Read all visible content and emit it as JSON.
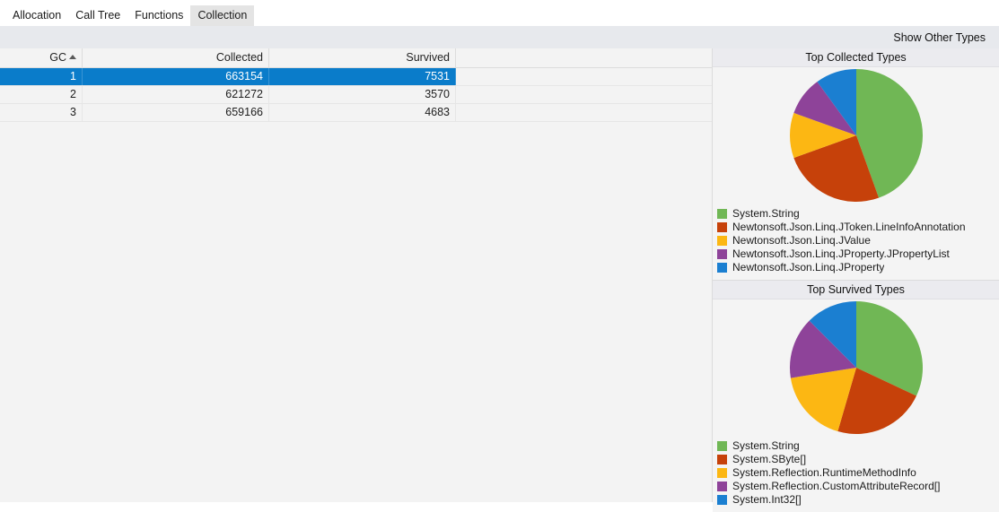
{
  "tabs": [
    {
      "label": "Allocation",
      "selected": false
    },
    {
      "label": "Call Tree",
      "selected": false
    },
    {
      "label": "Functions",
      "selected": false
    },
    {
      "label": "Collection",
      "selected": true
    }
  ],
  "toolbar": {
    "show_other_types_label": "Show Other Types"
  },
  "grid": {
    "columns": [
      {
        "key": "gc",
        "label": "GC",
        "sorted": true,
        "sort_direction": "ascending"
      },
      {
        "key": "collected",
        "label": "Collected",
        "sorted": false
      },
      {
        "key": "survived",
        "label": "Survived",
        "sorted": false
      },
      {
        "key": "filler",
        "label": "",
        "sorted": false
      }
    ],
    "rows": [
      {
        "gc": "1",
        "collected": "663154",
        "survived": "7531",
        "selected": true
      },
      {
        "gc": "2",
        "collected": "621272",
        "survived": "3570",
        "selected": false
      },
      {
        "gc": "3",
        "collected": "659166",
        "survived": "4683",
        "selected": false
      }
    ]
  },
  "palette": {
    "green": "#70b755",
    "red": "#c6410a",
    "yellow": "#fcb713",
    "purple": "#8e4399",
    "blue": "#1b7fd1",
    "selection_blue": "#0a7cca"
  },
  "chart_data": [
    {
      "type": "pie",
      "title": "Top Collected Types",
      "legend_position": "bottom-left",
      "categories": [
        "System.String",
        "Newtonsoft.Json.Linq.JToken.LineInfoAnnotation",
        "Newtonsoft.Json.Linq.JValue",
        "Newtonsoft.Json.Linq.JProperty.JPropertyList",
        "Newtonsoft.Json.Linq.JProperty"
      ],
      "values": [
        44.5,
        25.0,
        11.0,
        9.5,
        10.0
      ],
      "colors": [
        "#70b755",
        "#c6410a",
        "#fcb713",
        "#8e4399",
        "#1b7fd1"
      ]
    },
    {
      "type": "pie",
      "title": "Top Survived Types",
      "legend_position": "bottom-left",
      "categories": [
        "System.String",
        "System.SByte[]",
        "System.Reflection.RuntimeMethodInfo",
        "System.Reflection.CustomAttributeRecord[]",
        "System.Int32[]"
      ],
      "values": [
        32.0,
        22.5,
        18.0,
        15.0,
        12.5
      ],
      "colors": [
        "#70b755",
        "#c6410a",
        "#fcb713",
        "#8e4399",
        "#1b7fd1"
      ]
    }
  ]
}
